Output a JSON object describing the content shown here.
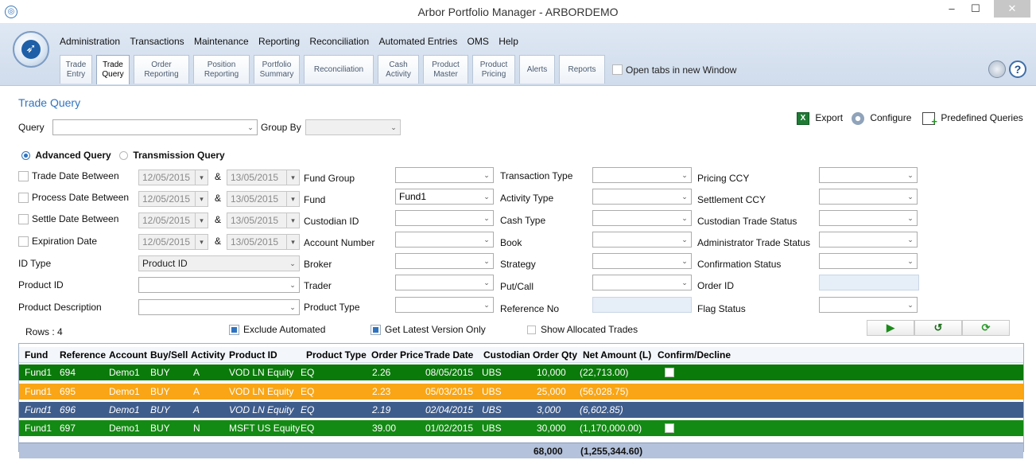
{
  "window": {
    "title": "Arbor Portfolio Manager - ARBORDEMO",
    "minimize": "–",
    "maximize": "☐",
    "close": "✕"
  },
  "menu": [
    "Administration",
    "Transactions",
    "Maintenance",
    "Reporting",
    "Reconciliation",
    "Automated Entries",
    "OMS",
    "Help"
  ],
  "tabs": [
    {
      "label": "Trade\nEntry"
    },
    {
      "label": "Trade\nQuery"
    },
    {
      "label": "Order\nReporting"
    },
    {
      "label": "Position\nReporting"
    },
    {
      "label": "Portfolio\nSummary"
    },
    {
      "label": "Reconciliation"
    },
    {
      "label": "Cash\nActivity"
    },
    {
      "label": "Product\nMaster"
    },
    {
      "label": "Product\nPricing"
    },
    {
      "label": "Alerts"
    },
    {
      "label": "Reports"
    }
  ],
  "open_tabs_label": "Open tabs in new Window",
  "page_title": "Trade Query",
  "query_label": "Query",
  "group_by_label": "Group By",
  "export_label": "Export",
  "configure_label": "Configure",
  "predefined_label": "Predefined Queries",
  "advanced_query": "Advanced Query",
  "transmission_query": "Transmission Query",
  "dates": [
    {
      "label": "Trade Date Between",
      "from": "12/05/2015",
      "to": "13/05/2015"
    },
    {
      "label": "Process Date Between",
      "from": "12/05/2015",
      "to": "13/05/2015"
    },
    {
      "label": "Settle Date Between",
      "from": "12/05/2015",
      "to": "13/05/2015"
    },
    {
      "label": "Expiration Date",
      "from": "12/05/2015",
      "to": "13/05/2015"
    }
  ],
  "amp": "&",
  "id_type_label": "ID Type",
  "id_type_value": "Product ID",
  "product_id_label": "Product ID",
  "product_desc_label": "Product Description",
  "col2": [
    "Fund Group",
    "Fund",
    "Custodian ID",
    "Account Number",
    "Broker",
    "Trader",
    "Product Type"
  ],
  "fund_value": "Fund1",
  "col3": [
    "Transaction Type",
    "Activity Type",
    "Cash Type",
    "Book",
    "Strategy",
    "Put/Call",
    "Reference No"
  ],
  "col4": [
    "Pricing CCY",
    "Settlement CCY",
    "Custodian Trade Status",
    "Administrator Trade Status",
    "Confirmation Status",
    "Order ID",
    "Flag Status"
  ],
  "rows_label": "Rows : 4",
  "exclude_automated": "Exclude Automated",
  "latest_version": "Get Latest Version Only",
  "show_allocated": "Show Allocated Trades",
  "grid": {
    "headers": [
      "Fund",
      "Reference",
      "Account",
      "Buy/Sell",
      "Activity",
      "Product ID",
      "Product Type",
      "Order Price",
      "Trade Date",
      "Custodian",
      "Order Qty",
      "Net Amount (L)",
      "Confirm/Decline"
    ],
    "rows": [
      {
        "fund": "Fund1",
        "ref": "694",
        "account": "Demo1",
        "bs": "BUY",
        "activity": "A",
        "product": "VOD LN Equity",
        "ptype": "EQ",
        "price": "2.26",
        "date": "08/05/2015",
        "custodian": "UBS",
        "qty": "10,000",
        "net": "(22,713.00)",
        "confirm": true
      },
      {
        "fund": "Fund1",
        "ref": "695",
        "account": "Demo1",
        "bs": "BUY",
        "activity": "A",
        "product": "VOD LN Equity",
        "ptype": "EQ",
        "price": "2.23",
        "date": "05/03/2015",
        "custodian": "UBS",
        "qty": "25,000",
        "net": "(56,028.75)",
        "confirm": false
      },
      {
        "fund": "Fund1",
        "ref": "696",
        "account": "Demo1",
        "bs": "BUY",
        "activity": "A",
        "product": "VOD LN Equity",
        "ptype": "EQ",
        "price": "2.19",
        "date": "02/04/2015",
        "custodian": "UBS",
        "qty": "3,000",
        "net": "(6,602.85)",
        "confirm": false
      },
      {
        "fund": "Fund1",
        "ref": "697",
        "account": "Demo1",
        "bs": "BUY",
        "activity": "N",
        "product": "MSFT US Equity",
        "ptype": "EQ",
        "price": "39.00",
        "date": "01/02/2015",
        "custodian": "UBS",
        "qty": "30,000",
        "net": "(1,170,000.00)",
        "confirm": true
      }
    ],
    "totals": {
      "qty": "68,000",
      "net": "(1,255,344.60)"
    }
  },
  "colors": {
    "row1": "#0a7a0a",
    "row2": "#f9a515",
    "row3": "#3f5d8c",
    "row4": "#138a13",
    "accent": "#2f74c0"
  }
}
